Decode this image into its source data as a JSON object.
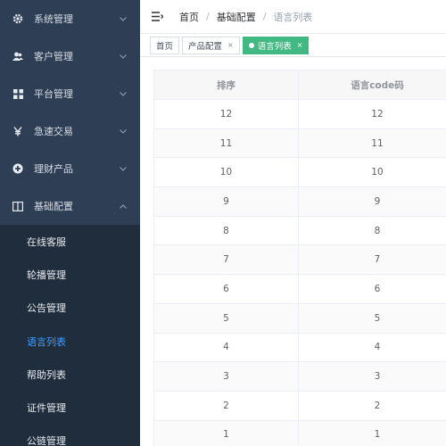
{
  "colors": {
    "sidebar_bg": "#2e3f55",
    "submenu_bg": "#1f2d3d",
    "active_accent": "#409eff",
    "active_tag": "#42b983"
  },
  "sidebar": {
    "menus": [
      {
        "label": "系统管理",
        "icon": "gear-icon"
      },
      {
        "label": "客户管理",
        "icon": "users-icon"
      },
      {
        "label": "平台管理",
        "icon": "grid-icon"
      },
      {
        "label": "急速交易",
        "icon": "yen-icon"
      },
      {
        "label": "理财产品",
        "icon": "circle-plus-icon"
      },
      {
        "label": "基础配置",
        "icon": "book-icon"
      }
    ],
    "submenu": [
      {
        "label": "在线客服"
      },
      {
        "label": "轮播管理"
      },
      {
        "label": "公告管理"
      },
      {
        "label": "语言列表"
      },
      {
        "label": "帮助列表"
      },
      {
        "label": "证件管理"
      },
      {
        "label": "公链管理"
      }
    ]
  },
  "header": {
    "breadcrumb": [
      "首页",
      "基础配置",
      "语言列表"
    ],
    "separator": "/"
  },
  "tags": [
    {
      "label": "首页"
    },
    {
      "label": "产品配置",
      "close": "×"
    },
    {
      "label": "语言列表",
      "close": "×"
    }
  ],
  "table": {
    "columns": [
      "排序",
      "语言code码"
    ],
    "rows": [
      [
        "12",
        "12"
      ],
      [
        "11",
        "11"
      ],
      [
        "10",
        "10"
      ],
      [
        "9",
        "9"
      ],
      [
        "8",
        "8"
      ],
      [
        "7",
        "7"
      ],
      [
        "6",
        "6"
      ],
      [
        "5",
        "5"
      ],
      [
        "4",
        "4"
      ],
      [
        "3",
        "3"
      ],
      [
        "2",
        "2"
      ],
      [
        "1",
        "1"
      ]
    ]
  }
}
